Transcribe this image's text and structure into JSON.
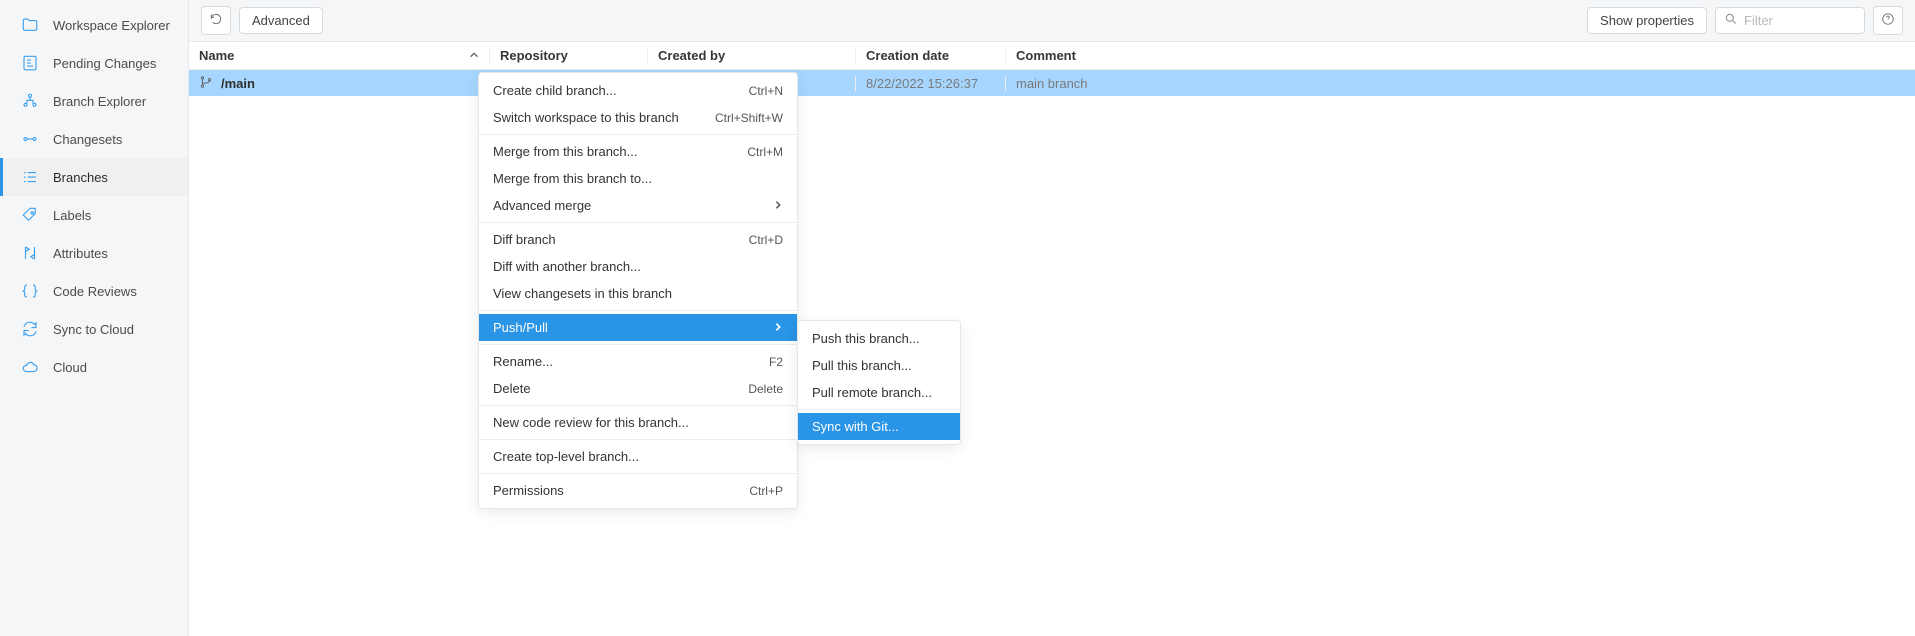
{
  "sidebar": {
    "items": [
      {
        "label": "Workspace Explorer"
      },
      {
        "label": "Pending Changes"
      },
      {
        "label": "Branch Explorer"
      },
      {
        "label": "Changesets"
      },
      {
        "label": "Branches"
      },
      {
        "label": "Labels"
      },
      {
        "label": "Attributes"
      },
      {
        "label": "Code Reviews"
      },
      {
        "label": "Sync to Cloud"
      },
      {
        "label": "Cloud"
      }
    ]
  },
  "toolbar": {
    "advanced": "Advanced",
    "show_properties": "Show properties",
    "filter_placeholder": "Filter"
  },
  "columns": {
    "name": "Name",
    "repo": "Repository",
    "by": "Created by",
    "date": "Creation date",
    "comment": "Comment"
  },
  "rows": [
    {
      "name": "/main",
      "date": "8/22/2022 15:26:37",
      "comment": "main branch"
    }
  ],
  "menu": {
    "items": [
      {
        "label": "Create child branch...",
        "shortcut": "Ctrl+N"
      },
      {
        "label": "Switch workspace to this branch",
        "shortcut": "Ctrl+Shift+W"
      },
      {
        "sep": true
      },
      {
        "label": "Merge from this branch...",
        "shortcut": "Ctrl+M"
      },
      {
        "label": "Merge from this branch to..."
      },
      {
        "label": "Advanced merge",
        "submenu": true
      },
      {
        "sep": true
      },
      {
        "label": "Diff branch",
        "shortcut": "Ctrl+D"
      },
      {
        "label": "Diff with another branch..."
      },
      {
        "label": "View changesets in this branch"
      },
      {
        "sep": true
      },
      {
        "label": "Push/Pull",
        "submenu": true,
        "hover": true
      },
      {
        "sep": true
      },
      {
        "label": "Rename...",
        "shortcut": "F2"
      },
      {
        "label": "Delete",
        "shortcut": "Delete"
      },
      {
        "sep": true
      },
      {
        "label": "New code review for this branch..."
      },
      {
        "sep": true
      },
      {
        "label": "Create top-level branch..."
      },
      {
        "sep": true
      },
      {
        "label": "Permissions",
        "shortcut": "Ctrl+P"
      }
    ],
    "sub": [
      {
        "label": "Push this branch..."
      },
      {
        "label": "Pull this branch..."
      },
      {
        "label": "Pull remote branch..."
      },
      {
        "sep": true
      },
      {
        "label": "Sync with Git...",
        "hover": true
      }
    ]
  }
}
